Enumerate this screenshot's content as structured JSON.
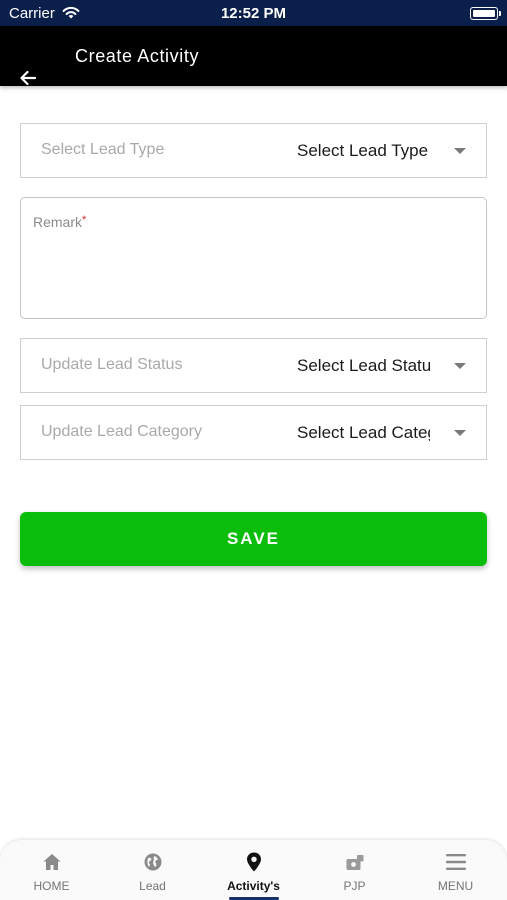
{
  "status_bar": {
    "carrier": "Carrier",
    "time": "12:52 PM"
  },
  "header": {
    "title": "Create Activity"
  },
  "form": {
    "lead_type": {
      "label": "Select Lead Type",
      "value": "Select Lead Type"
    },
    "remark": {
      "label": "Remark",
      "required_mark": "*"
    },
    "lead_status": {
      "label": "Update Lead Status",
      "value": "Select Lead Status"
    },
    "lead_category": {
      "label": "Update Lead Category",
      "value": "Select Lead Category"
    },
    "save_label": "SAVE"
  },
  "bottom_nav": {
    "items": [
      {
        "label": "HOME",
        "icon": "home-icon"
      },
      {
        "label": "Lead",
        "icon": "globe-icon"
      },
      {
        "label": "Activity's",
        "icon": "location-pin-icon",
        "active": true
      },
      {
        "label": "PJP",
        "icon": "pjp-icon"
      },
      {
        "label": "MENU",
        "icon": "menu-icon"
      }
    ]
  },
  "colors": {
    "status_bar": "#0b1f4b",
    "app_bar": "#000000",
    "save_button": "#0bbd0b",
    "active_indicator": "#17306b"
  }
}
